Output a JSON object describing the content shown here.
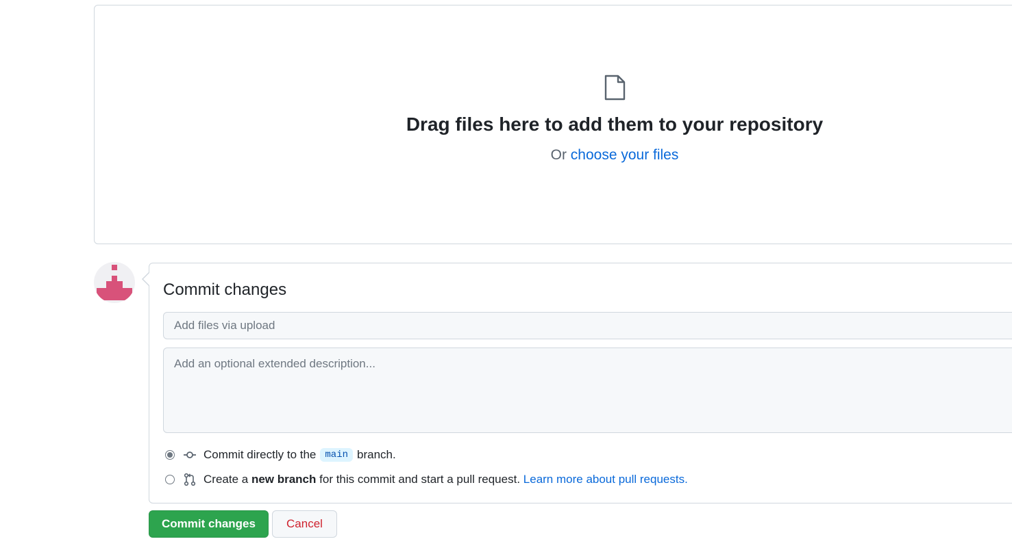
{
  "upload": {
    "icon": "file-icon",
    "title": "Drag files here to add them to your repository",
    "sub_prefix": "Or",
    "choose_link": "choose your files"
  },
  "avatar": {
    "icon": "identicon-avatar",
    "color": "#d8527a"
  },
  "commit": {
    "title": "Commit changes",
    "summary_placeholder": "Add files via upload",
    "summary_value": "",
    "description_placeholder": "Add an optional extended description...",
    "description_value": "",
    "options": [
      {
        "icon": "git-commit-icon",
        "checked": true,
        "text_before": "Commit directly to the",
        "branch": "main",
        "text_after": "branch."
      },
      {
        "icon": "git-pull-request-icon",
        "checked": false,
        "text_before": "Create a",
        "bold": "new branch",
        "text_after": "for this commit and start a pull request.",
        "link": "Learn more about pull requests."
      }
    ]
  },
  "buttons": {
    "commit_label": "Commit changes",
    "cancel_label": "Cancel"
  },
  "colors": {
    "primary": "#2da44e",
    "link": "#0969da",
    "danger": "#cf222e",
    "border": "#d0d7de"
  }
}
